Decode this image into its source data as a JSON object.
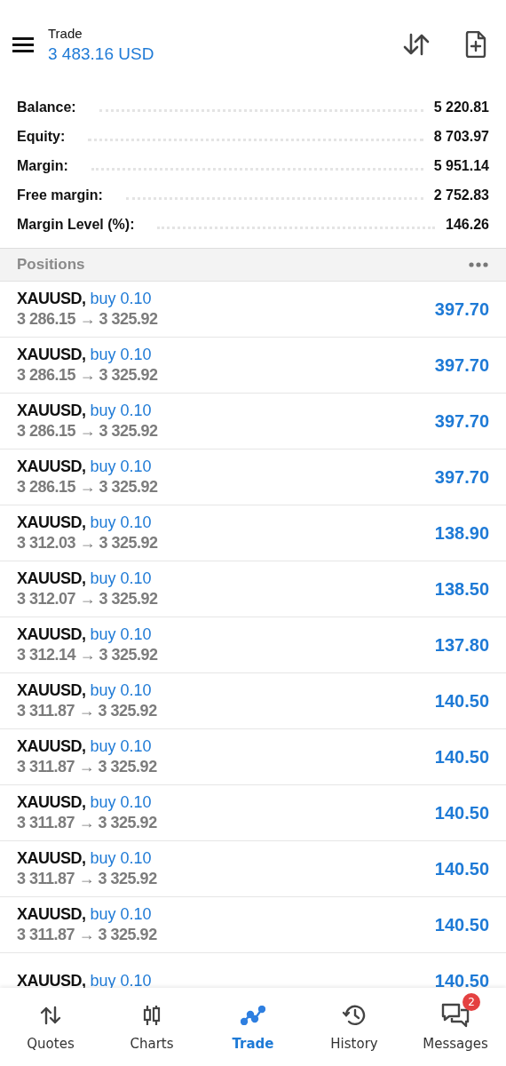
{
  "header": {
    "title": "Trade",
    "balance": "3 483.16 USD"
  },
  "summary": [
    {
      "label": "Balance:",
      "value": "5 220.81"
    },
    {
      "label": "Equity:",
      "value": "8 703.97"
    },
    {
      "label": "Margin:",
      "value": "5 951.14"
    },
    {
      "label": "Free margin:",
      "value": "2 752.83"
    },
    {
      "label": "Margin Level (%):",
      "value": "146.26"
    }
  ],
  "positions": {
    "title": "Positions",
    "rows": [
      {
        "symbol": "XAUUSD,",
        "order": "buy 0.10",
        "prices": "3 286.15 → 3 325.92",
        "profit": "397.70"
      },
      {
        "symbol": "XAUUSD,",
        "order": "buy 0.10",
        "prices": "3 286.15 → 3 325.92",
        "profit": "397.70"
      },
      {
        "symbol": "XAUUSD,",
        "order": "buy 0.10",
        "prices": "3 286.15 → 3 325.92",
        "profit": "397.70"
      },
      {
        "symbol": "XAUUSD,",
        "order": "buy 0.10",
        "prices": "3 286.15 → 3 325.92",
        "profit": "397.70"
      },
      {
        "symbol": "XAUUSD,",
        "order": "buy 0.10",
        "prices": "3 312.03 → 3 325.92",
        "profit": "138.90"
      },
      {
        "symbol": "XAUUSD,",
        "order": "buy 0.10",
        "prices": "3 312.07 → 3 325.92",
        "profit": "138.50"
      },
      {
        "symbol": "XAUUSD,",
        "order": "buy 0.10",
        "prices": "3 312.14 → 3 325.92",
        "profit": "137.80"
      },
      {
        "symbol": "XAUUSD,",
        "order": "buy 0.10",
        "prices": "3 311.87 → 3 325.92",
        "profit": "140.50"
      },
      {
        "symbol": "XAUUSD,",
        "order": "buy 0.10",
        "prices": "3 311.87 → 3 325.92",
        "profit": "140.50"
      },
      {
        "symbol": "XAUUSD,",
        "order": "buy 0.10",
        "prices": "3 311.87 → 3 325.92",
        "profit": "140.50"
      },
      {
        "symbol": "XAUUSD,",
        "order": "buy 0.10",
        "prices": "3 311.87 → 3 325.92",
        "profit": "140.50"
      },
      {
        "symbol": "XAUUSD,",
        "order": "buy 0.10",
        "prices": "3 311.87 → 3 325.92",
        "profit": "140.50"
      },
      {
        "symbol": "XAUUSD,",
        "order": "buy 0.10",
        "profit": "140.50"
      }
    ]
  },
  "nav": [
    {
      "kind": "quotes",
      "label": "Quotes",
      "selected": false
    },
    {
      "kind": "charts",
      "label": "Charts",
      "selected": false
    },
    {
      "kind": "trade",
      "label": "Trade",
      "selected": true
    },
    {
      "kind": "history",
      "label": "History",
      "selected": false
    },
    {
      "kind": "messages",
      "label": "Messages",
      "selected": false,
      "badge": "2"
    }
  ]
}
